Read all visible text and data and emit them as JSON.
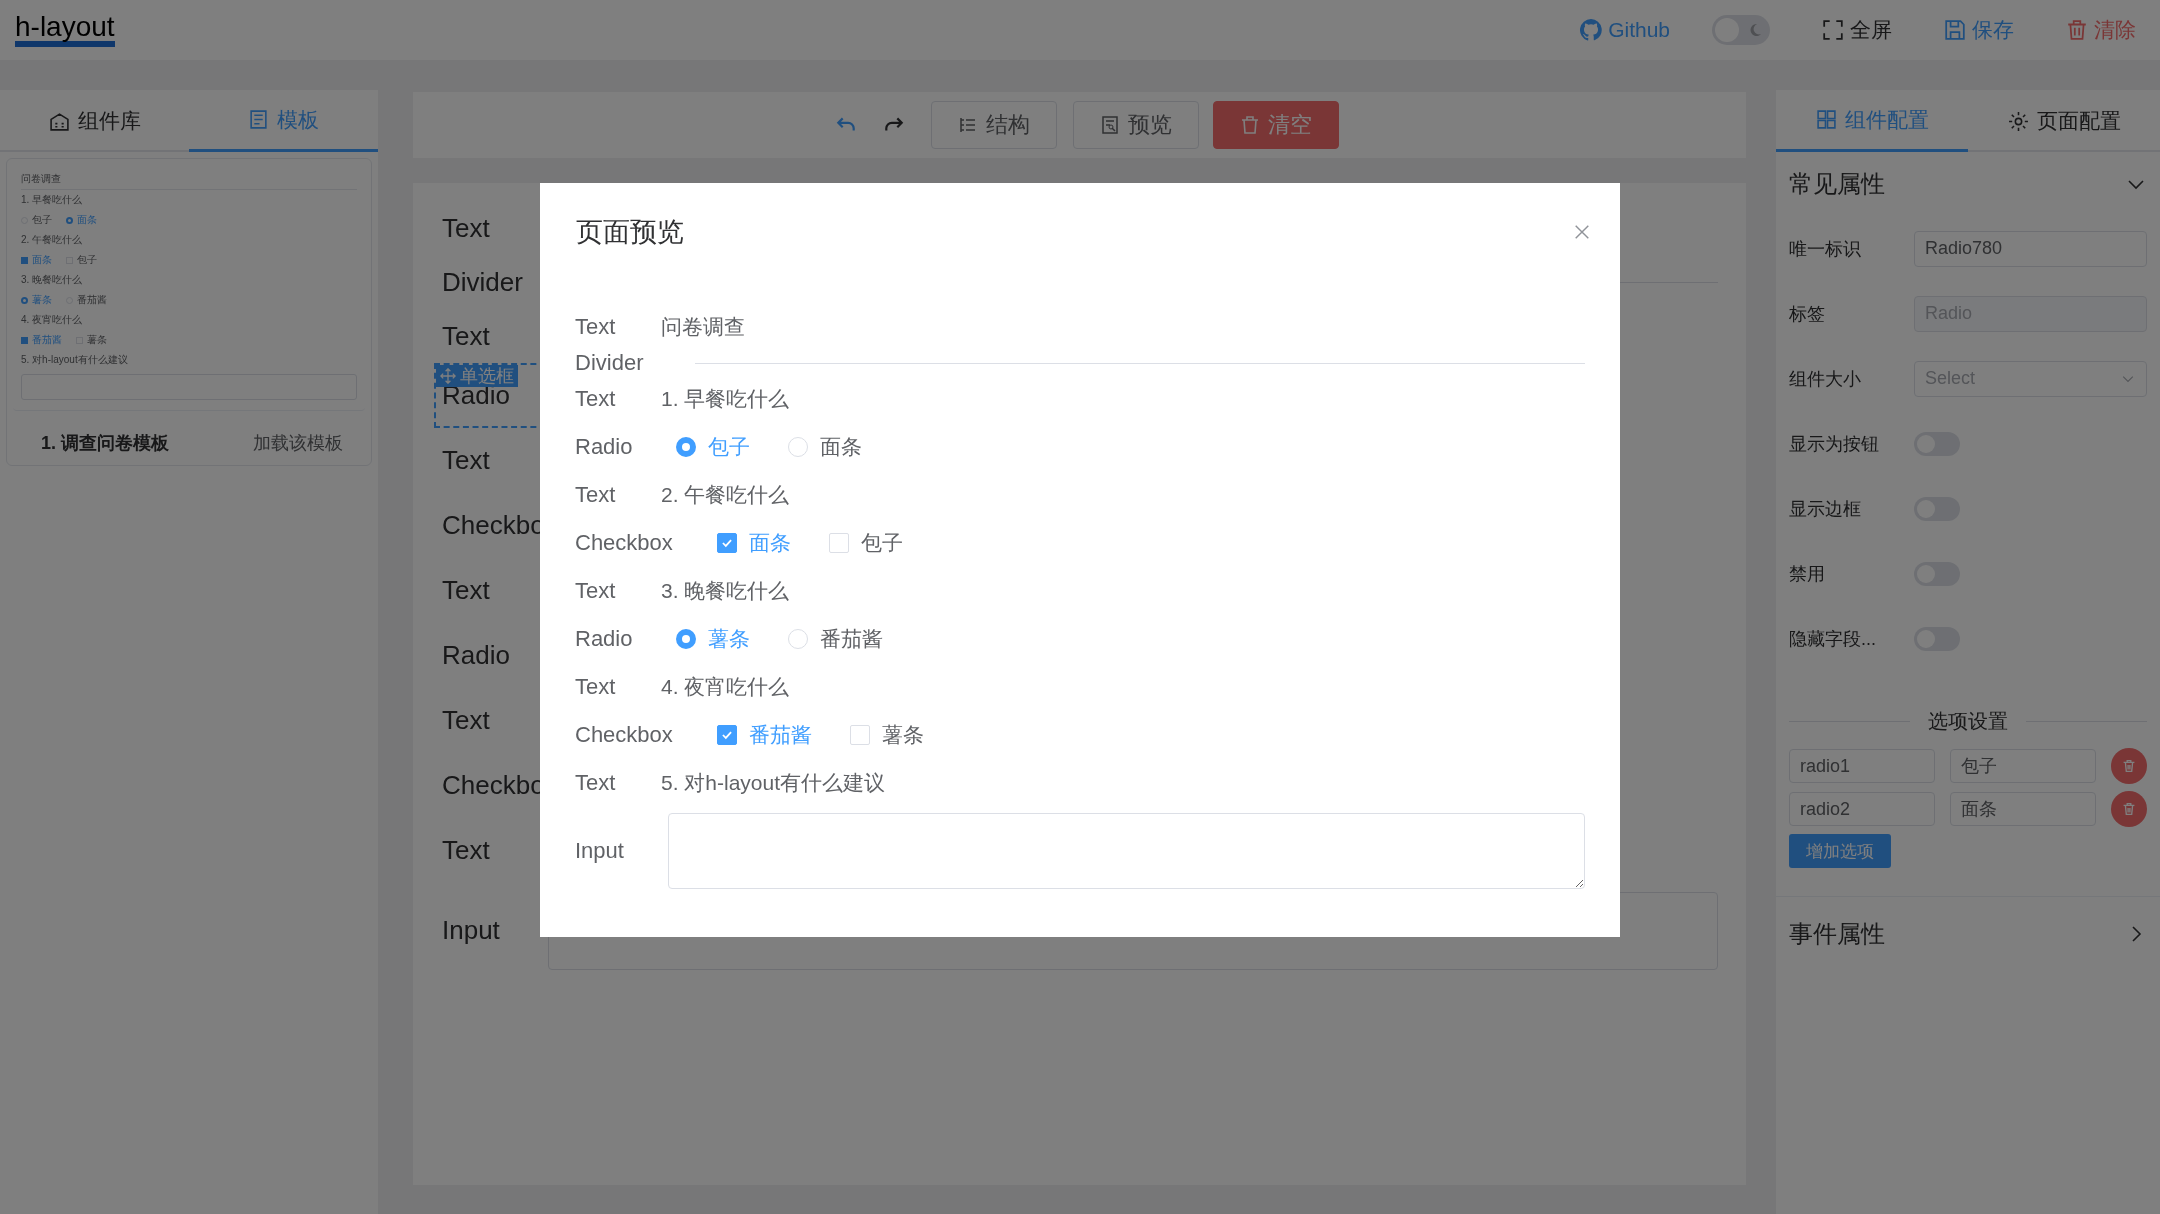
{
  "header": {
    "logo": "h-layout",
    "github": {
      "label": "Github"
    },
    "dark_mode": {
      "on": false
    },
    "actions": [
      {
        "kind": "fullscreen",
        "label": "全屏"
      },
      {
        "kind": "save",
        "label": "保存"
      },
      {
        "kind": "clear",
        "label": "清除"
      }
    ]
  },
  "left_panel": {
    "tabs": [
      {
        "label": "组件库",
        "selected": false
      },
      {
        "label": "模板",
        "selected": true
      }
    ],
    "template": {
      "preview": [
        {
          "kind": "text",
          "text": "问卷调查"
        },
        {
          "kind": "divider"
        },
        {
          "kind": "text",
          "text": "1. 早餐吃什么"
        },
        {
          "kind": "radio",
          "options": [
            {
              "label": "包子",
              "checked": false
            },
            {
              "label": "面条",
              "checked": true
            }
          ]
        },
        {
          "kind": "text",
          "text": "2. 午餐吃什么"
        },
        {
          "kind": "checkbox",
          "options": [
            {
              "label": "面条",
              "checked": true
            },
            {
              "label": "包子",
              "checked": false
            }
          ]
        },
        {
          "kind": "text",
          "text": "3. 晚餐吃什么"
        },
        {
          "kind": "radio",
          "options": [
            {
              "label": "薯条",
              "checked": true
            },
            {
              "label": "番茄酱",
              "checked": false
            }
          ]
        },
        {
          "kind": "text",
          "text": "4. 夜宵吃什么"
        },
        {
          "kind": "checkbox",
          "options": [
            {
              "label": "番茄酱",
              "checked": true
            },
            {
              "label": "薯条",
              "checked": false
            }
          ]
        },
        {
          "kind": "text",
          "text": "5. 对h-layout有什么建议"
        },
        {
          "kind": "textarea"
        }
      ],
      "name": "1. 调查问卷模板",
      "load_link": "加载该模板"
    }
  },
  "toolbar": {
    "buttons": [
      {
        "kind": "structure",
        "label": "结构"
      },
      {
        "kind": "preview",
        "label": "预览"
      },
      {
        "kind": "clear",
        "label": "清空"
      }
    ]
  },
  "canvas": {
    "selected_tag": "单选框",
    "rows": [
      {
        "kind": "text",
        "label": "Text",
        "selected": false
      },
      {
        "kind": "divider",
        "label": "Divider",
        "selected": false
      },
      {
        "kind": "text",
        "label": "Text",
        "selected": false
      },
      {
        "kind": "radio",
        "label": "Radio",
        "selected": true
      },
      {
        "kind": "text",
        "label": "Text",
        "selected": false
      },
      {
        "kind": "checkbox",
        "label": "Checkbo",
        "selected": false
      },
      {
        "kind": "text",
        "label": "Text",
        "selected": false
      },
      {
        "kind": "radio",
        "label": "Radio",
        "selected": false
      },
      {
        "kind": "text",
        "label": "Text",
        "selected": false
      },
      {
        "kind": "checkbox",
        "label": "Checkbo",
        "selected": false
      },
      {
        "kind": "text",
        "label": "Text",
        "selected": false
      },
      {
        "kind": "input",
        "label": "Input",
        "selected": false
      }
    ]
  },
  "modal": {
    "title": "页面预览",
    "rows": [
      {
        "kind": "text",
        "label": "Text",
        "text": "问卷调查"
      },
      {
        "kind": "divider",
        "label": "Divider"
      },
      {
        "kind": "text",
        "label": "Text",
        "text": "1. 早餐吃什么"
      },
      {
        "kind": "radio",
        "label": "Radio",
        "options": [
          {
            "label": "包子",
            "checked": true
          },
          {
            "label": "面条",
            "checked": false
          }
        ]
      },
      {
        "kind": "text",
        "label": "Text",
        "text": "2. 午餐吃什么"
      },
      {
        "kind": "checkbox",
        "label": "Checkbox",
        "options": [
          {
            "label": "面条",
            "checked": true
          },
          {
            "label": "包子",
            "checked": false
          }
        ]
      },
      {
        "kind": "text",
        "label": "Text",
        "text": "3. 晚餐吃什么"
      },
      {
        "kind": "radio",
        "label": "Radio",
        "options": [
          {
            "label": "薯条",
            "checked": true
          },
          {
            "label": "番茄酱",
            "checked": false
          }
        ]
      },
      {
        "kind": "text",
        "label": "Text",
        "text": "4. 夜宵吃什么"
      },
      {
        "kind": "checkbox",
        "label": "Checkbox",
        "options": [
          {
            "label": "番茄酱",
            "checked": true
          },
          {
            "label": "薯条",
            "checked": false
          }
        ]
      },
      {
        "kind": "text",
        "label": "Text",
        "text": "5. 对h-layout有什么建议"
      },
      {
        "kind": "input",
        "label": "Input"
      }
    ]
  },
  "right_panel": {
    "tabs": [
      {
        "label": "组件配置",
        "selected": true
      },
      {
        "label": "页面配置",
        "selected": false
      }
    ],
    "common_section": {
      "title": "常见属性",
      "expanded": true,
      "fields": [
        {
          "kind": "input",
          "label": "唯一标识",
          "value": "Radio780",
          "disabled": false
        },
        {
          "kind": "input",
          "label": "标签",
          "value": "Radio",
          "disabled": true
        },
        {
          "kind": "select",
          "label": "组件大小",
          "placeholder": "Select",
          "disabled": false
        },
        {
          "kind": "switch",
          "label": "显示为按钮",
          "on": false
        },
        {
          "kind": "switch",
          "label": "显示边框",
          "on": false
        },
        {
          "kind": "switch",
          "label": "禁用",
          "on": false
        },
        {
          "kind": "switch",
          "label": "隐藏字段...",
          "on": false
        }
      ]
    },
    "options_section": {
      "title": "选项设置",
      "options": [
        {
          "value": "radio1",
          "label": "包子"
        },
        {
          "value": "radio2",
          "label": "面条"
        }
      ],
      "add_button": "增加选项"
    },
    "event_section": {
      "title": "事件属性",
      "expanded": false
    }
  }
}
